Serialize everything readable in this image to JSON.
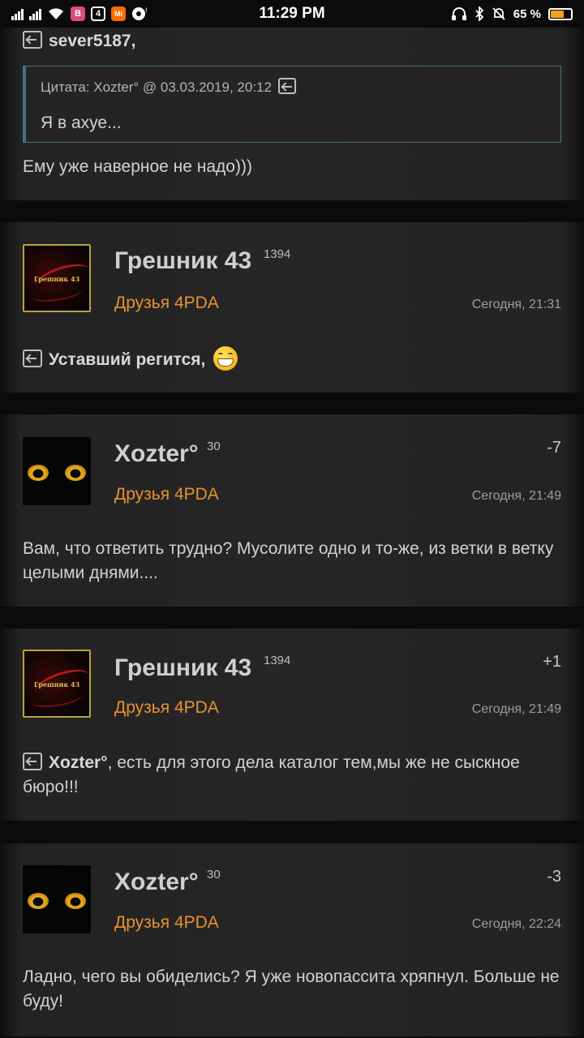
{
  "status_bar": {
    "time": "11:29 PM",
    "battery": "65 %",
    "app_icons": [
      "B",
      "4",
      "Mi"
    ],
    "icons": [
      "signal-icon",
      "wifi-icon",
      "headphones-icon",
      "bluetooth-icon",
      "mute-bell-icon",
      "battery-icon"
    ]
  },
  "partial_post": {
    "reply_to": "sever5187,",
    "quote": {
      "header": "Цитата: Xozter° @ 03.03.2019, 20:12",
      "text": "Я в ахуе..."
    },
    "message": "Ему уже наверное не надо)))"
  },
  "posts": [
    {
      "author": "Грешник 43",
      "reputation": "1394",
      "group": "Друзья 4PDA",
      "time": "Сегодня, 21:31",
      "karma": "",
      "avatar_label": "Грешник 43",
      "reply_to": "Уставший регится,",
      "message": ""
    },
    {
      "author": "Xozter°",
      "reputation": "30",
      "group": "Друзья 4PDA",
      "time": "Сегодня, 21:49",
      "karma": "-7",
      "message": "Вам, что ответить трудно? Мусолите одно и то-же, из ветки в ветку целыми днями...."
    },
    {
      "author": "Грешник 43",
      "reputation": "1394",
      "group": "Друзья 4PDA",
      "time": "Сегодня, 21:49",
      "karma": "+1",
      "avatar_label": "Грешник 43",
      "reply_to": "Xozter°",
      "message": ", есть для этого дела каталог тем,мы же не сыскное бюро!!!"
    },
    {
      "author": "Xozter°",
      "reputation": "30",
      "group": "Друзья 4PDA",
      "time": "Сегодня, 22:24",
      "karma": "-3",
      "message": "Ладно, чего вы обиделись? Я уже новопассита хряпнул. Больше не буду!"
    }
  ],
  "colors": {
    "group": "#e8922e",
    "card_bg": "#262626",
    "page_bg": "#0b0b0b",
    "quote_border": "#4a7277"
  }
}
